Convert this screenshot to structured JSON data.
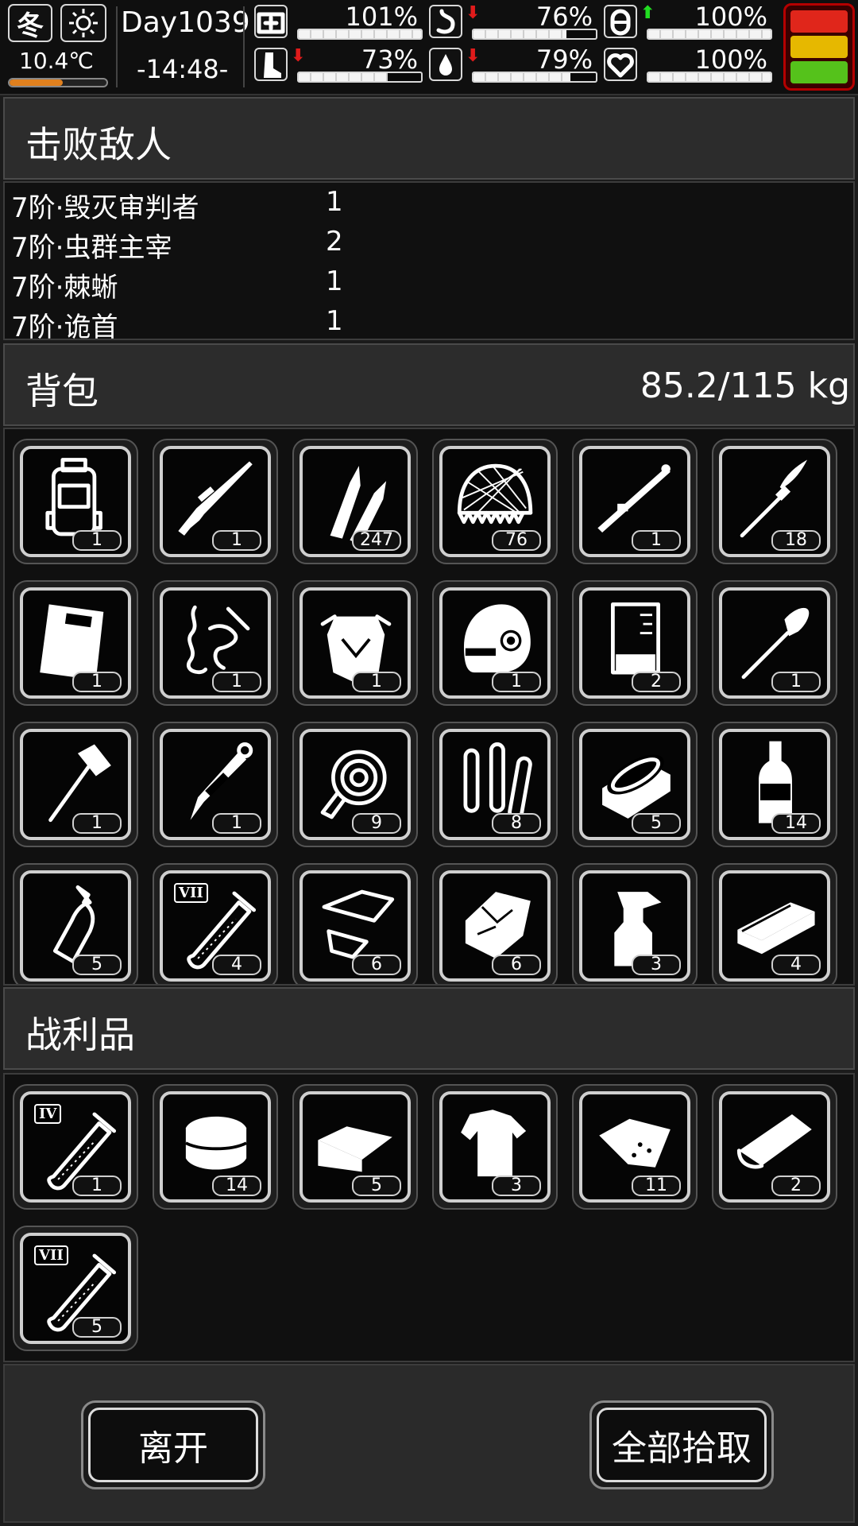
{
  "status": {
    "season": "冬",
    "weather_icon": "sun-icon",
    "temperature": "10.4℃",
    "temperature_level": 0.55,
    "day": "Day1039",
    "clock": "-14:48-",
    "stats": [
      {
        "id": "health",
        "icon": "first-aid-icon",
        "value": "101%",
        "level": 1.0,
        "arrow": ""
      },
      {
        "id": "hunger",
        "icon": "stomach-icon",
        "value": "76%",
        "level": 0.76,
        "arrow": "down"
      },
      {
        "id": "mood",
        "icon": "pill-icon",
        "value": "100%",
        "level": 1.0,
        "arrow": "up"
      },
      {
        "id": "stamina",
        "icon": "foot-icon",
        "value": "73%",
        "level": 0.73,
        "arrow": "down"
      },
      {
        "id": "thirst",
        "icon": "water-drop-icon",
        "value": "79%",
        "level": 0.79,
        "arrow": "down"
      },
      {
        "id": "spirit",
        "icon": "heart-icon",
        "value": "100%",
        "level": 1.0,
        "arrow": ""
      }
    ],
    "traffic_colors": [
      "#e0261b",
      "#e6b800",
      "#55c21b"
    ]
  },
  "defeated": {
    "title": "击败敌人",
    "enemies": [
      {
        "name": "7阶·毁灭审判者",
        "count": "1"
      },
      {
        "name": "7阶·虫群主宰",
        "count": "2"
      },
      {
        "name": "7阶·棘蜥",
        "count": "1"
      },
      {
        "name": "7阶·诡首",
        "count": "1"
      }
    ]
  },
  "backpack": {
    "title": "背包",
    "weight": "85.2/115 kg",
    "items": [
      {
        "icon": "backpack-icon",
        "qty": "1"
      },
      {
        "icon": "sniper-rifle-icon",
        "qty": "1"
      },
      {
        "icon": "bullets-icon",
        "qty": "247"
      },
      {
        "icon": "net-icon",
        "qty": "76"
      },
      {
        "icon": "rocket-launcher-icon",
        "qty": "1"
      },
      {
        "icon": "rocket-icon",
        "qty": "18"
      },
      {
        "icon": "riot-shield-icon",
        "qty": "1"
      },
      {
        "icon": "tentacle-arm-icon",
        "qty": "1"
      },
      {
        "icon": "armor-vest-icon",
        "qty": "1"
      },
      {
        "icon": "helmet-icon",
        "qty": "1"
      },
      {
        "icon": "beaker-icon",
        "qty": "2"
      },
      {
        "icon": "shovel-icon",
        "qty": "1"
      },
      {
        "icon": "axe-icon",
        "qty": "1"
      },
      {
        "icon": "knife-icon",
        "qty": "1"
      },
      {
        "icon": "rope-icon",
        "qty": "9"
      },
      {
        "icon": "test-tubes-icon",
        "qty": "8"
      },
      {
        "icon": "canned-food-icon",
        "qty": "5"
      },
      {
        "icon": "liquor-bottle-icon",
        "qty": "14"
      },
      {
        "icon": "milk-bottle-icon",
        "qty": "5"
      },
      {
        "icon": "test-tube-vii-icon",
        "qty": "4",
        "label": "VII"
      },
      {
        "icon": "cloth-scraps-icon",
        "qty": "6"
      },
      {
        "icon": "crumpled-paper-icon",
        "qty": "6"
      },
      {
        "icon": "spray-bottle-icon",
        "qty": "3"
      },
      {
        "icon": "brick-icon",
        "qty": "4"
      }
    ]
  },
  "loot": {
    "title": "战利品",
    "items": [
      {
        "icon": "test-tube-iv-icon",
        "qty": "1",
        "label": "IV"
      },
      {
        "icon": "folded-towel-icon",
        "qty": "14"
      },
      {
        "icon": "cloth-sheets-icon",
        "qty": "5"
      },
      {
        "icon": "torn-shirt-icon",
        "qty": "3"
      },
      {
        "icon": "meat-icon",
        "qty": "11"
      },
      {
        "icon": "fabric-roll-icon",
        "qty": "2"
      },
      {
        "icon": "test-tube-vii-icon",
        "qty": "5",
        "label": "VII"
      }
    ]
  },
  "buttons": {
    "leave": "离开",
    "pickup_all": "全部拾取"
  }
}
